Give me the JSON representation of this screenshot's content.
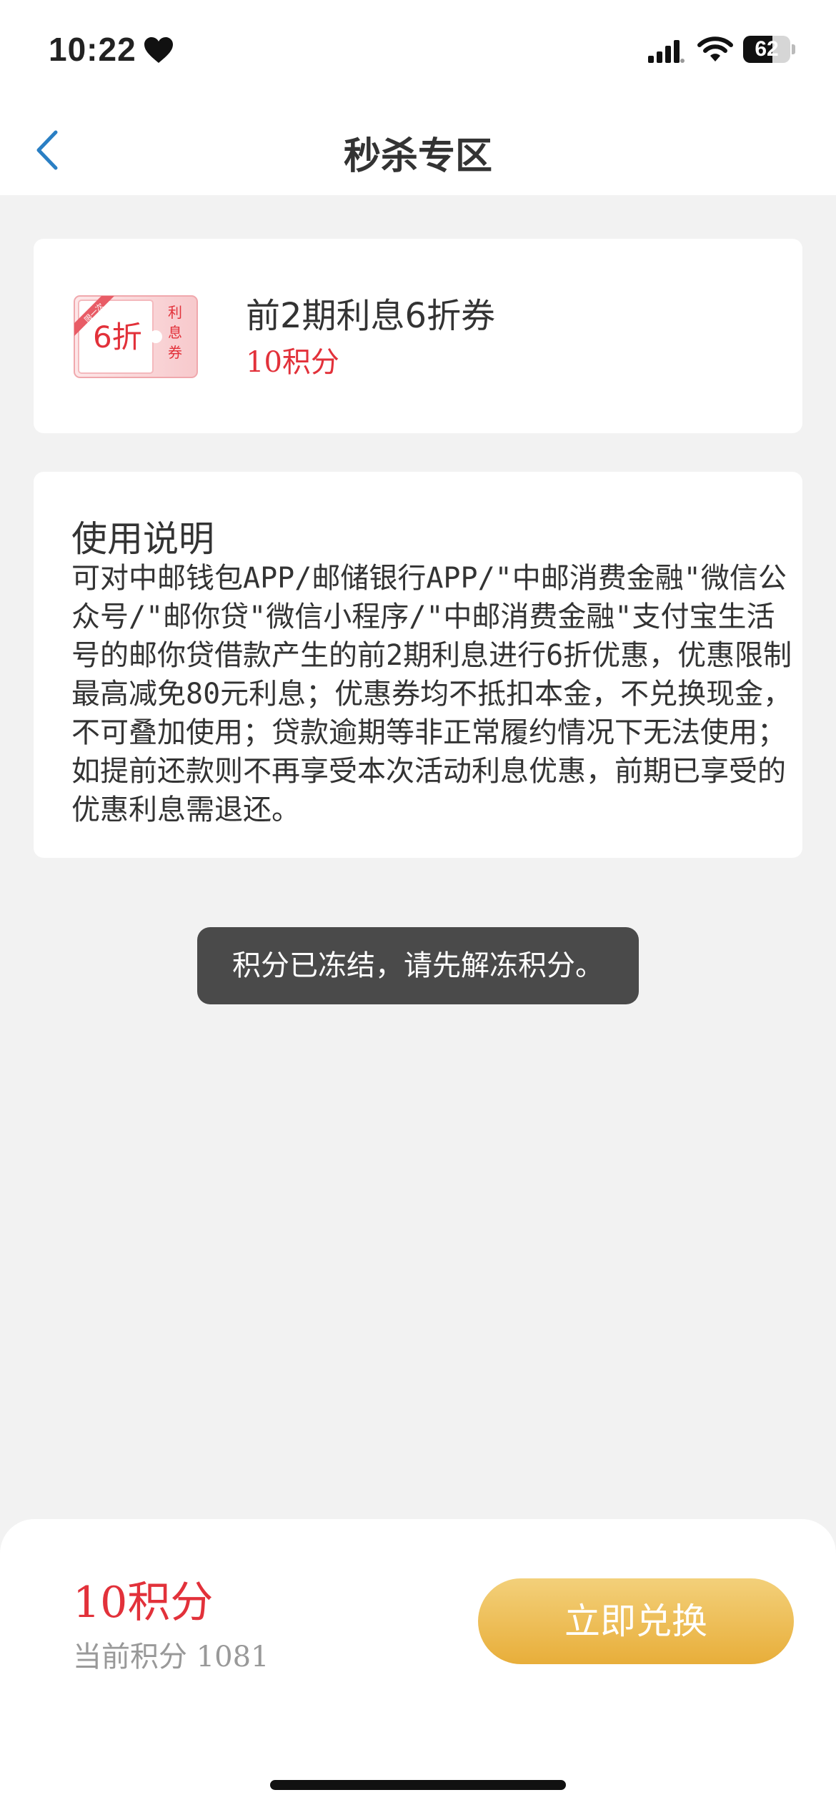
{
  "status_bar": {
    "time": "10:22",
    "battery_level": "62"
  },
  "nav": {
    "title": "秒杀专区",
    "back_icon": "chevron-left-icon"
  },
  "coupon": {
    "icon_discount": "6折",
    "icon_label": "利息券",
    "icon_ribbon": "限一次",
    "name": "前2期利息6折券",
    "points": "10积分"
  },
  "instructions": {
    "title": "使用说明",
    "body": "可对中邮钱包APP/邮储银行APP/\"中邮消费金融\"微信公众号/\"邮你贷\"微信小程序/\"中邮消费金融\"支付宝生活号的邮你贷借款产生的前2期利息进行6折优惠，优惠限制最高减免80元利息；优惠券均不抵扣本金，不兑换现金，不可叠加使用；贷款逾期等非正常履约情况下无法使用；如提前还款则不再享受本次活动利息优惠，前期已享受的优惠利息需退还。"
  },
  "toast": {
    "message": "积分已冻结，请先解冻积分。"
  },
  "footer": {
    "price": "10积分",
    "balance": "当前积分 1081",
    "button_label": "立即兑换"
  },
  "colors": {
    "accent_red": "#e2313a",
    "button_gold": "#e8ae3a",
    "back_blue": "#2a7fc4"
  }
}
